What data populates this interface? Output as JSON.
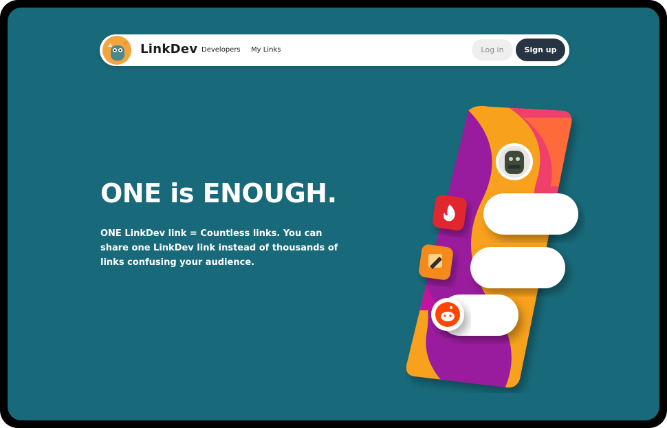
{
  "navbar": {
    "brand": "LinkDev",
    "links": [
      "Developers",
      "My Links"
    ],
    "login_label": "Log in",
    "signup_label": "Sign up"
  },
  "hero": {
    "headline": "ONE is ENOUGH.",
    "subtext": "ONE LinkDev link = Countless links. You can share one LinkDev link instead of thousands of links confusing your audience."
  },
  "colors": {
    "background": "#186a7a",
    "signup_button": "#273442",
    "login_button": "#efefef",
    "accent_purple": "#9a1f9e",
    "accent_orange": "#f7a11a",
    "accent_red": "#e0282e"
  },
  "illustration": {
    "icons": [
      "tinder-icon",
      "pencil-note-icon",
      "reddit-icon",
      "avatar-icon"
    ]
  }
}
